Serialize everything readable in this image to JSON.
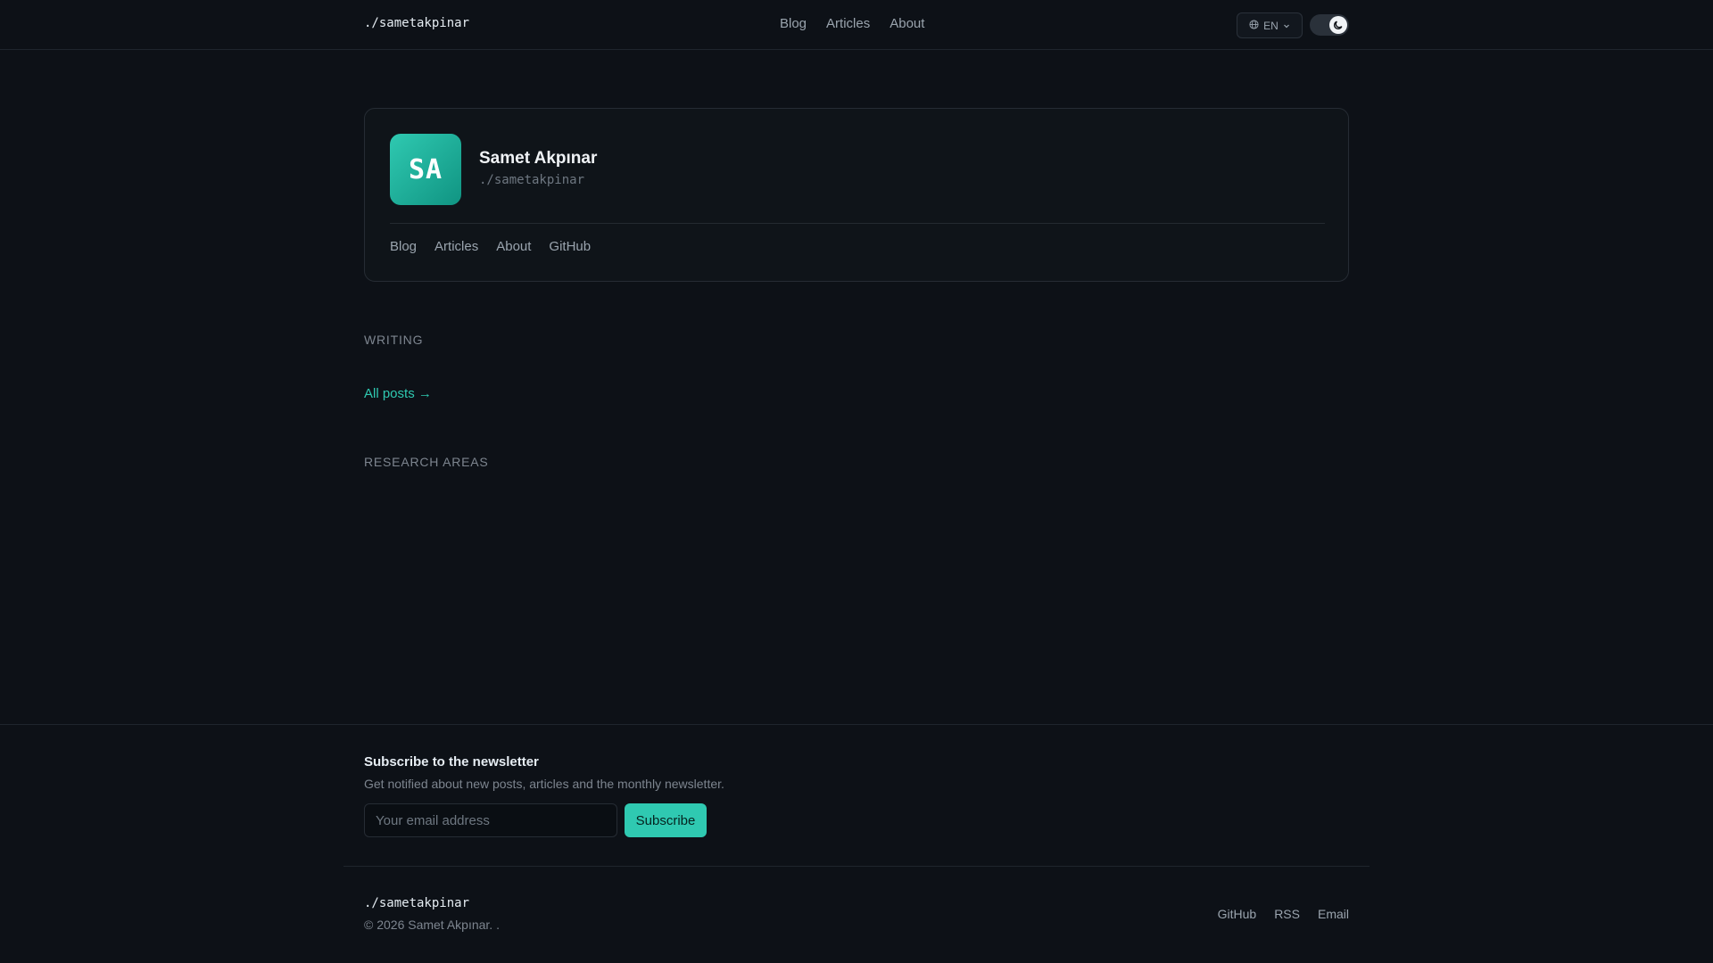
{
  "header": {
    "brand": "./sametakpinar",
    "nav": [
      "Blog",
      "Articles",
      "About"
    ],
    "language": "EN",
    "theme_icon": "moon-icon"
  },
  "profile": {
    "initials": "SA",
    "name": "Samet Akpınar",
    "handle": "./sametakpinar",
    "links": [
      "Blog",
      "Articles",
      "About",
      "GitHub"
    ]
  },
  "sections": {
    "writing": "WRITING",
    "all_posts": "All posts →",
    "research": "RESEARCH AREAS"
  },
  "newsletter": {
    "title": "Subscribe to the newsletter",
    "subtitle": "Get notified about new posts, articles and the monthly newsletter.",
    "email_placeholder": "Your email address",
    "button": "Subscribe"
  },
  "footer": {
    "brand": "./sametakpinar",
    "copyright": "© 2026 Samet Akpınar. .",
    "links": [
      "GitHub",
      "RSS",
      "Email"
    ]
  },
  "colors": {
    "background": "#0d1117",
    "accent": "#2fc9b1"
  }
}
